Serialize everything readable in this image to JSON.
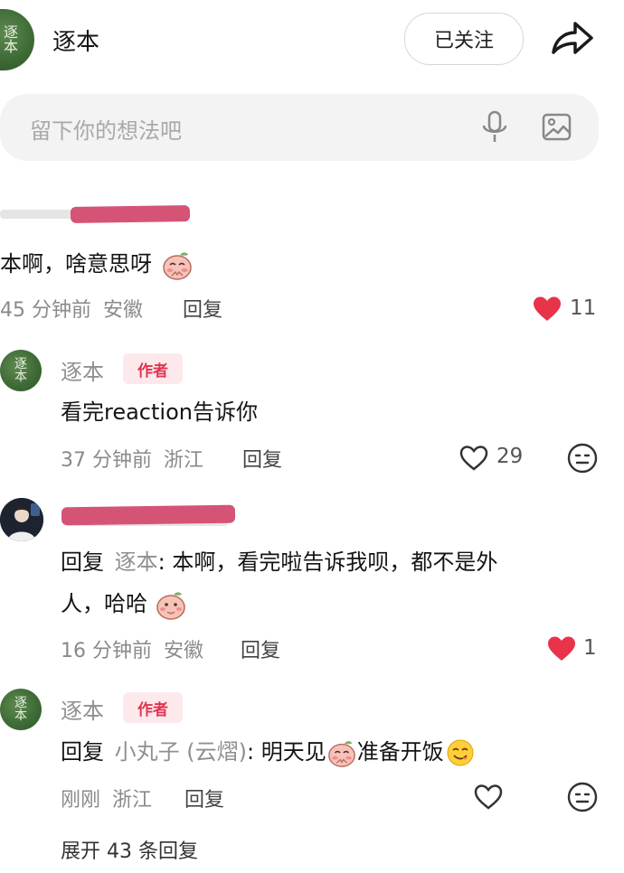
{
  "header": {
    "avatar_text": [
      "逐",
      "本"
    ],
    "username": "逐本",
    "follow_label": "已关注"
  },
  "search": {
    "placeholder": "留下你的想法吧"
  },
  "comments": [
    {
      "text": "本啊，啥意思呀",
      "time": "45 分钟前",
      "location": "安徽",
      "reply_label": "回复",
      "likes": "11",
      "liked": true
    },
    {
      "name": "逐本",
      "badge": "作者",
      "avatar_text": [
        "逐",
        "本"
      ],
      "text": "看完reaction告诉你",
      "time": "37 分钟前",
      "location": "浙江",
      "reply_label": "回复",
      "likes": "29",
      "liked": false
    },
    {
      "reply_prefix": "回复",
      "reply_to": "逐本",
      "text_line1": ": 本啊，看完啦告诉我呗，都不是外",
      "text_line2": "人，哈哈",
      "time": "16 分钟前",
      "location": "安徽",
      "reply_label": "回复",
      "likes": "1",
      "liked": true
    },
    {
      "name": "逐本",
      "badge": "作者",
      "avatar_text": [
        "逐",
        "本"
      ],
      "reply_prefix": "回复",
      "reply_to": "小丸子 (云熠)",
      "text_a": ": 明天见",
      "text_b": "准备开饭",
      "time": "刚刚",
      "location": "浙江",
      "reply_label": "回复",
      "liked": false
    }
  ],
  "expand_label": "展开 43 条回复",
  "colors": {
    "like_red": "#e8334a",
    "author_badge_bg": "#fde9ec",
    "author_badge_text": "#e0344f",
    "avatar_green": "#3f6b36",
    "redaction": "#d55475"
  },
  "icons": [
    "share-icon",
    "microphone-icon",
    "image-icon",
    "heart-icon",
    "dislike-face-icon"
  ]
}
